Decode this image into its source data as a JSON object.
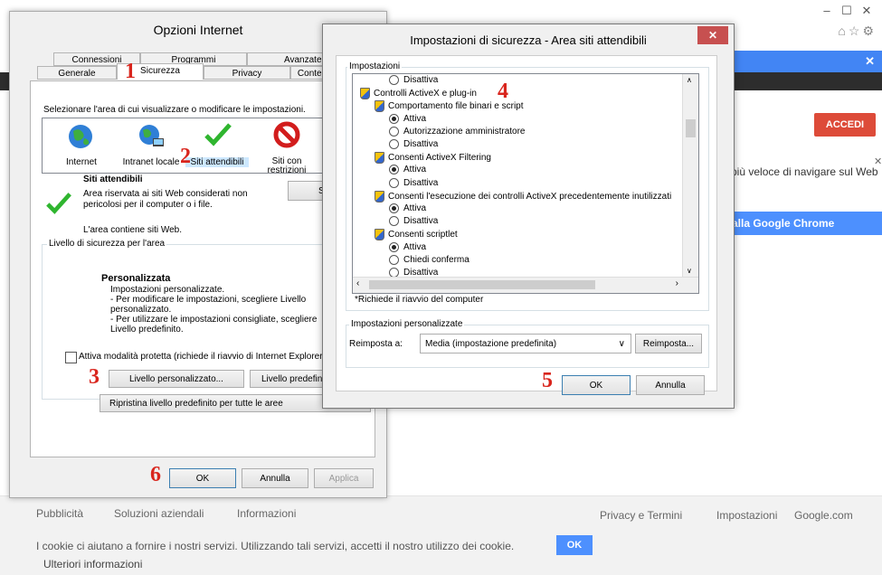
{
  "browser": {
    "accedi": "ACCEDI",
    "promo_text": "più veloce di navigare sul Web",
    "chrome_button": "alla Google Chrome",
    "footer": {
      "pubblicita": "Pubblicità",
      "soluzioni": "Soluzioni aziendali",
      "informazioni": "Informazioni",
      "privacy": "Privacy e Termini",
      "impostazioni": "Impostazioni",
      "google": "Google.com",
      "cookie_text": "I cookie ci aiutano a fornire i nostri servizi. Utilizzando tali servizi, accetti il nostro utilizzo dei cookie.",
      "cookie_ok": "OK",
      "more_info": "Ulteriori informazioni"
    }
  },
  "opzioni": {
    "title": "Opzioni Internet",
    "tabs_row1": [
      "Connessioni",
      "Programmi",
      "Avanzate"
    ],
    "tabs_row2": [
      "Generale",
      "Sicurezza",
      "Privacy",
      "Contenuto"
    ],
    "select_zone": "Selezionare l'area di cui visualizzare o modificare le impostazioni.",
    "zones": [
      "Internet",
      "Intranet locale",
      "Siti attendibili",
      "Siti con restrizioni"
    ],
    "zone_name": "Siti attendibili",
    "zone_desc": "Area riservata ai siti Web considerati non pericolosi per il computer o i file.",
    "zone_contains": "L'area contiene siti Web.",
    "sites_button": "Siti",
    "level_group": "Livello di sicurezza per l'area",
    "custom_title": "Personalizzata",
    "custom_lines": [
      "Impostazioni personalizzate.",
      "- Per modificare le impostazioni, scegliere Livello",
      "personalizzato.",
      "- Per utilizzare le impostazioni consigliate, scegliere",
      "Livello predefinito."
    ],
    "protected_mode": "Attiva modalità protetta (richiede il riavvio di Internet Explorer)",
    "custom_level_button": "Livello personalizzato...",
    "default_level_button": "Livello predefinito",
    "reset_all_button": "Ripristina livello predefinito per tutte le aree",
    "ok": "OK",
    "cancel": "Annulla",
    "apply": "Applica"
  },
  "security": {
    "title": "Impostazioni di sicurezza - Area siti attendibili",
    "close": "✕",
    "settings_group": "Impostazioni",
    "tree": [
      {
        "kind": "radio",
        "on": false,
        "label": "Disattiva"
      },
      {
        "kind": "category",
        "label": "Controlli ActiveX e plug-in"
      },
      {
        "kind": "setting",
        "label": "Comportamento file binari e script"
      },
      {
        "kind": "radio",
        "on": true,
        "label": "Attiva"
      },
      {
        "kind": "radio",
        "on": false,
        "label": "Autorizzazione amministratore"
      },
      {
        "kind": "radio",
        "on": false,
        "label": "Disattiva"
      },
      {
        "kind": "setting",
        "label": "Consenti ActiveX Filtering"
      },
      {
        "kind": "radio",
        "on": true,
        "label": "Attiva"
      },
      {
        "kind": "radio",
        "on": false,
        "label": "Disattiva"
      },
      {
        "kind": "setting",
        "label": "Consenti l'esecuzione dei controlli ActiveX precedentemente inutilizzati"
      },
      {
        "kind": "radio",
        "on": true,
        "label": "Attiva"
      },
      {
        "kind": "radio",
        "on": false,
        "label": "Disattiva"
      },
      {
        "kind": "setting",
        "label": "Consenti scriptlet"
      },
      {
        "kind": "radio",
        "on": true,
        "label": "Attiva"
      },
      {
        "kind": "radio",
        "on": false,
        "label": "Chiedi conferma"
      },
      {
        "kind": "radio",
        "on": false,
        "label": "Disattiva"
      }
    ],
    "restart_note": "*Richiede il riavvio del computer",
    "custom_group": "Impostazioni personalizzate",
    "reset_to_label": "Reimposta a:",
    "reset_select": "Media (impostazione predefinita)",
    "reset_button": "Reimposta...",
    "ok": "OK",
    "cancel": "Annulla"
  },
  "markers": [
    "1",
    "2",
    "3",
    "4",
    "5",
    "6"
  ],
  "colors": {
    "marker": "#d9251d",
    "blue_bar": "#4285f4",
    "accedi": "#dd4b39"
  }
}
